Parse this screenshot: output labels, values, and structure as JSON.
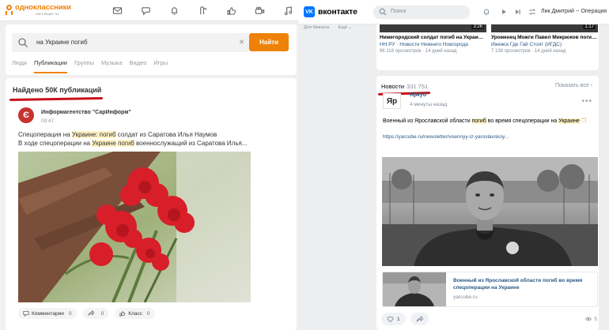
{
  "ok": {
    "logo_name": "одноклассники",
    "logo_sub": "настоящее ты",
    "nav_icons": [
      "mail-icon",
      "discussions-icon",
      "notifications-icon",
      "guests-icon",
      "likes-icon",
      "video-icon",
      "music-icon"
    ],
    "search": {
      "value": "на Украине погиб",
      "button": "Найти"
    },
    "tabs": [
      "Люди",
      "Публикации",
      "Группы",
      "Музыка",
      "Видео",
      "Игры"
    ],
    "active_tab": "Публикации",
    "found_text": "Найдено 50К публикаций",
    "post": {
      "source_name": "Информагентство \"СарИнформ\"",
      "source_letter": "Є",
      "time": "09:47",
      "line1": [
        "Спецоперация на ",
        "Украине: погиб",
        " солдат из Саратова Илья Наумов"
      ],
      "line2": [
        "В ходе спецоперации на ",
        "Украине",
        " ",
        "погиб",
        " военнослужащий из Саратова Илья..."
      ],
      "actions": [
        {
          "label": "Комментарии",
          "count": "0"
        },
        {
          "label": "",
          "count": "0"
        },
        {
          "label": "Класс",
          "count": "0"
        }
      ]
    }
  },
  "vk": {
    "logo_name": "вконтакте",
    "search_placeholder": "Поиск",
    "user_name": "Лик Дмитрий -- Операция",
    "left_links": [
      "Для бизнеса",
      "Ещё ⌄"
    ],
    "videos": [
      {
        "duration": "3:26",
        "title": "Нижегородский солдат погиб на Украине...",
        "source": "НН.РУ · Новости Нижнего Новгорода",
        "meta": "86 118 просмотров · 14 дней назад"
      },
      {
        "duration": "1:17",
        "title": "Уроженец Можги Павел Микрюков погиб...",
        "source": "Ижевск Где Гай Стоят (ИГДС)",
        "meta": "7 138 просмотров · 14 дней назад"
      }
    ],
    "news": {
      "title": "Новости",
      "count": "331 751",
      "show_all": "Показать все ›",
      "post": {
        "avatar_text": "Яр",
        "author": "Яркуб",
        "time": "4 минуты назад",
        "text": [
          "Военный из Ярославской области ",
          "погиб",
          " во время спецоперации на ",
          "Украине"
        ],
        "link": "https://yarcube.ru/newsletter/voennyy-iz-yaroslavskoy...",
        "attach_title": "Военный из Ярославской области погиб во время спецоперации на Украине",
        "attach_domain": "yarcube.ru",
        "likes": "1",
        "views": "5"
      }
    }
  }
}
